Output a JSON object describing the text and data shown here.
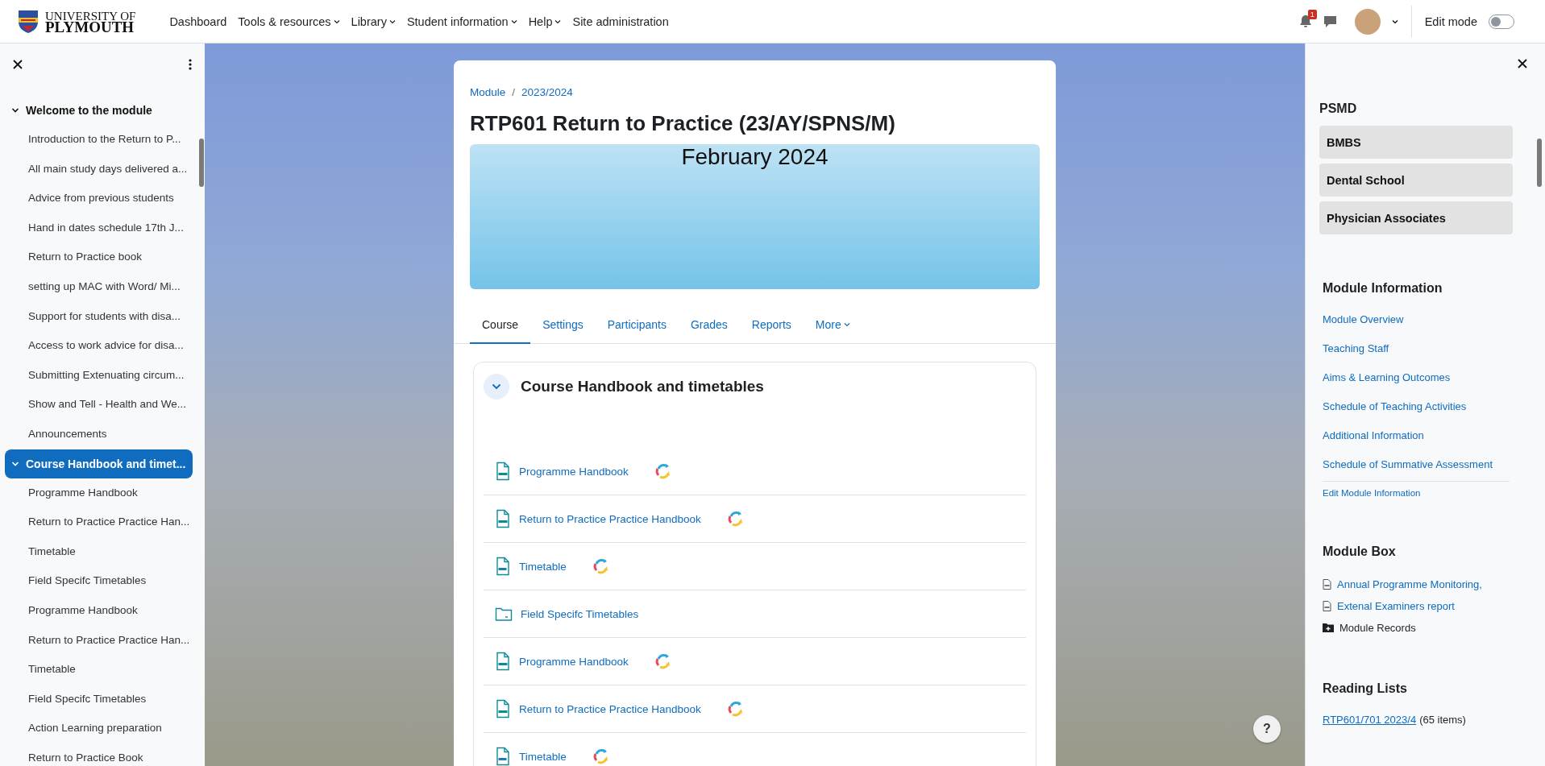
{
  "header": {
    "logo": {
      "line1": "UNIVERSITY OF",
      "line2": "PLYMOUTH"
    },
    "nav": [
      {
        "label": "Dashboard",
        "dropdown": false
      },
      {
        "label": "Tools & resources",
        "dropdown": true
      },
      {
        "label": "Library",
        "dropdown": true
      },
      {
        "label": "Student information",
        "dropdown": true
      },
      {
        "label": "Help",
        "dropdown": true
      },
      {
        "label": "Site administration",
        "dropdown": false
      }
    ],
    "notification_count": "1",
    "edit_mode": {
      "label": "Edit mode",
      "on": false
    }
  },
  "left_drawer": {
    "sections": [
      {
        "title": "Welcome to the module",
        "expanded": true,
        "selected": false,
        "items": [
          "Introduction to the Return to P...",
          "All main study days delivered a...",
          "Advice from previous students",
          "Hand in dates schedule 17th J...",
          "Return to Practice book",
          "setting up MAC with Word/ Mi...",
          "Support for students with disa...",
          "Access to work advice for disa...",
          "Submitting Extenuating circum...",
          "Show and Tell - Health and We...",
          "Announcements"
        ]
      },
      {
        "title": "Course Handbook and timet...",
        "expanded": true,
        "selected": true,
        "items": [
          "Programme Handbook",
          "Return to Practice Practice Han...",
          "Timetable",
          "Field Specifc Timetables",
          "Programme Handbook",
          "Return to Practice Practice Han...",
          "Timetable",
          "Field Specifc Timetables",
          "Action Learning preparation",
          "Return to Practice Book"
        ]
      }
    ]
  },
  "course": {
    "breadcrumb": [
      "Module",
      "2023/2024"
    ],
    "breadcrumb_separator": "/",
    "title": "RTP601 Return to Practice (23/AY/SPNS/M)",
    "banner_text": "February 2024",
    "tabs": [
      {
        "label": "Course",
        "selected": true,
        "dropdown": false
      },
      {
        "label": "Settings",
        "selected": false,
        "dropdown": false
      },
      {
        "label": "Participants",
        "selected": false,
        "dropdown": false
      },
      {
        "label": "Grades",
        "selected": false,
        "dropdown": false
      },
      {
        "label": "Reports",
        "selected": false,
        "dropdown": false
      },
      {
        "label": "More",
        "selected": false,
        "dropdown": true
      }
    ],
    "section": {
      "title": "Course Handbook and timetables",
      "expanded": true,
      "activities": [
        {
          "kind": "pdf",
          "title": "Programme Handbook",
          "sync": true
        },
        {
          "kind": "pdf",
          "title": "Return to Practice Practice Handbook",
          "sync": true
        },
        {
          "kind": "doc",
          "title": "Timetable",
          "sync": true
        },
        {
          "kind": "folder",
          "title": "Field Specifc Timetables",
          "sync": false
        },
        {
          "kind": "pdf",
          "title": "Programme Handbook",
          "sync": true
        },
        {
          "kind": "pdf",
          "title": "Return to Practice Practice Handbook",
          "sync": true
        },
        {
          "kind": "doc",
          "title": "Timetable",
          "sync": true
        }
      ]
    }
  },
  "right_drawer": {
    "school": {
      "title": "PSMD",
      "buttons": [
        "BMBS",
        "Dental School",
        "Physician Associates"
      ]
    },
    "module_information": {
      "title": "Module Information",
      "links": [
        "Module Overview",
        "Teaching Staff",
        "Aims & Learning Outcomes",
        "Schedule of Teaching Activities",
        "Additional Information",
        "Schedule of Summative Assessment"
      ],
      "edit_link": "Edit Module Information"
    },
    "module_box": {
      "title": "Module Box",
      "items": [
        {
          "kind": "doc",
          "label": "Annual Programme Monitoring,"
        },
        {
          "kind": "doc",
          "label": "Extenal Examiners report"
        },
        {
          "kind": "folder",
          "label": "Module Records"
        }
      ]
    },
    "reading_lists": {
      "title": "Reading Lists",
      "link": "RTP601/701 2023/4",
      "suffix": "(65 items)"
    }
  },
  "help_button": "?"
}
